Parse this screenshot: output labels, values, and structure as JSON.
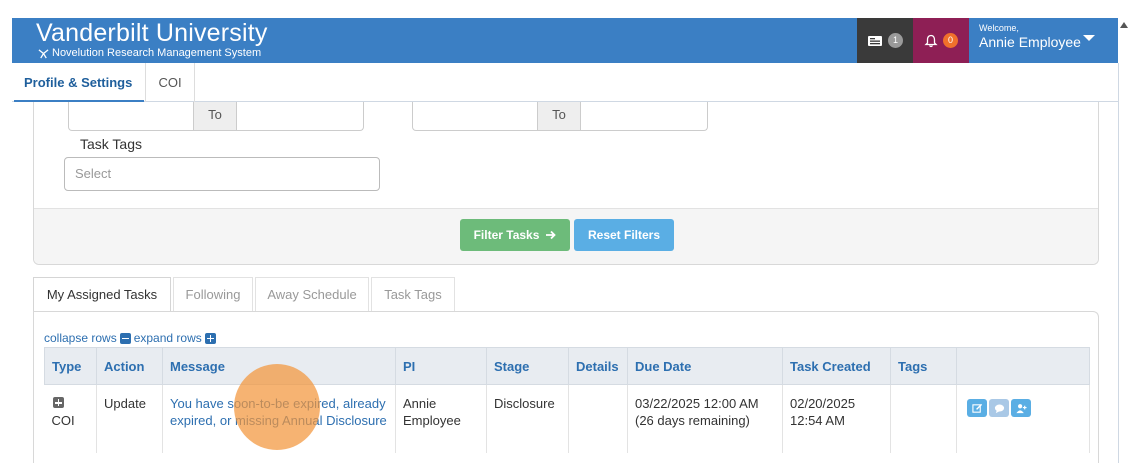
{
  "header": {
    "title": "Vanderbilt University",
    "subtitle": "Novelution Research Management System",
    "messages_count": "1",
    "alerts_count": "0",
    "welcome_label": "Welcome,",
    "user_name": "Annie Employee",
    "colors": {
      "header_bg": "#3b7fc4",
      "messages_bg": "#3a3a3a",
      "alerts_bg": "#8e1f55"
    }
  },
  "nav": {
    "tabs": [
      {
        "label": "Profile & Settings",
        "active": true
      },
      {
        "label": "COI",
        "active": false
      }
    ]
  },
  "filters": {
    "date_range_1": {
      "to_label": "To"
    },
    "date_range_2": {
      "to_label": "To"
    },
    "task_tags_label": "Task Tags",
    "task_tags_placeholder": "Select",
    "filter_button": "Filter Tasks",
    "reset_button": "Reset Filters"
  },
  "task_tabs": [
    {
      "label": "My Assigned Tasks",
      "active": true
    },
    {
      "label": "Following",
      "active": false
    },
    {
      "label": "Away Schedule",
      "active": false
    },
    {
      "label": "Task Tags",
      "active": false
    }
  ],
  "tasks": {
    "collapse_label": "collapse rows",
    "expand_label": "expand rows",
    "columns": [
      "Type",
      "Action",
      "Message",
      "PI",
      "Stage",
      "Details",
      "Due Date",
      "Task Created",
      "Tags",
      ""
    ],
    "rows": [
      {
        "type": "COI",
        "action": "Update",
        "message": "You have soon-to-be expired, already expired, or missing Annual Disclosure",
        "pi": "Annie Employee",
        "stage": "Disclosure",
        "details": "",
        "due_date": "03/22/2025 12:00 AM",
        "due_note": "(26 days remaining)",
        "created_date": "02/20/2025",
        "created_time": "12:54 AM",
        "tags": ""
      }
    ]
  }
}
